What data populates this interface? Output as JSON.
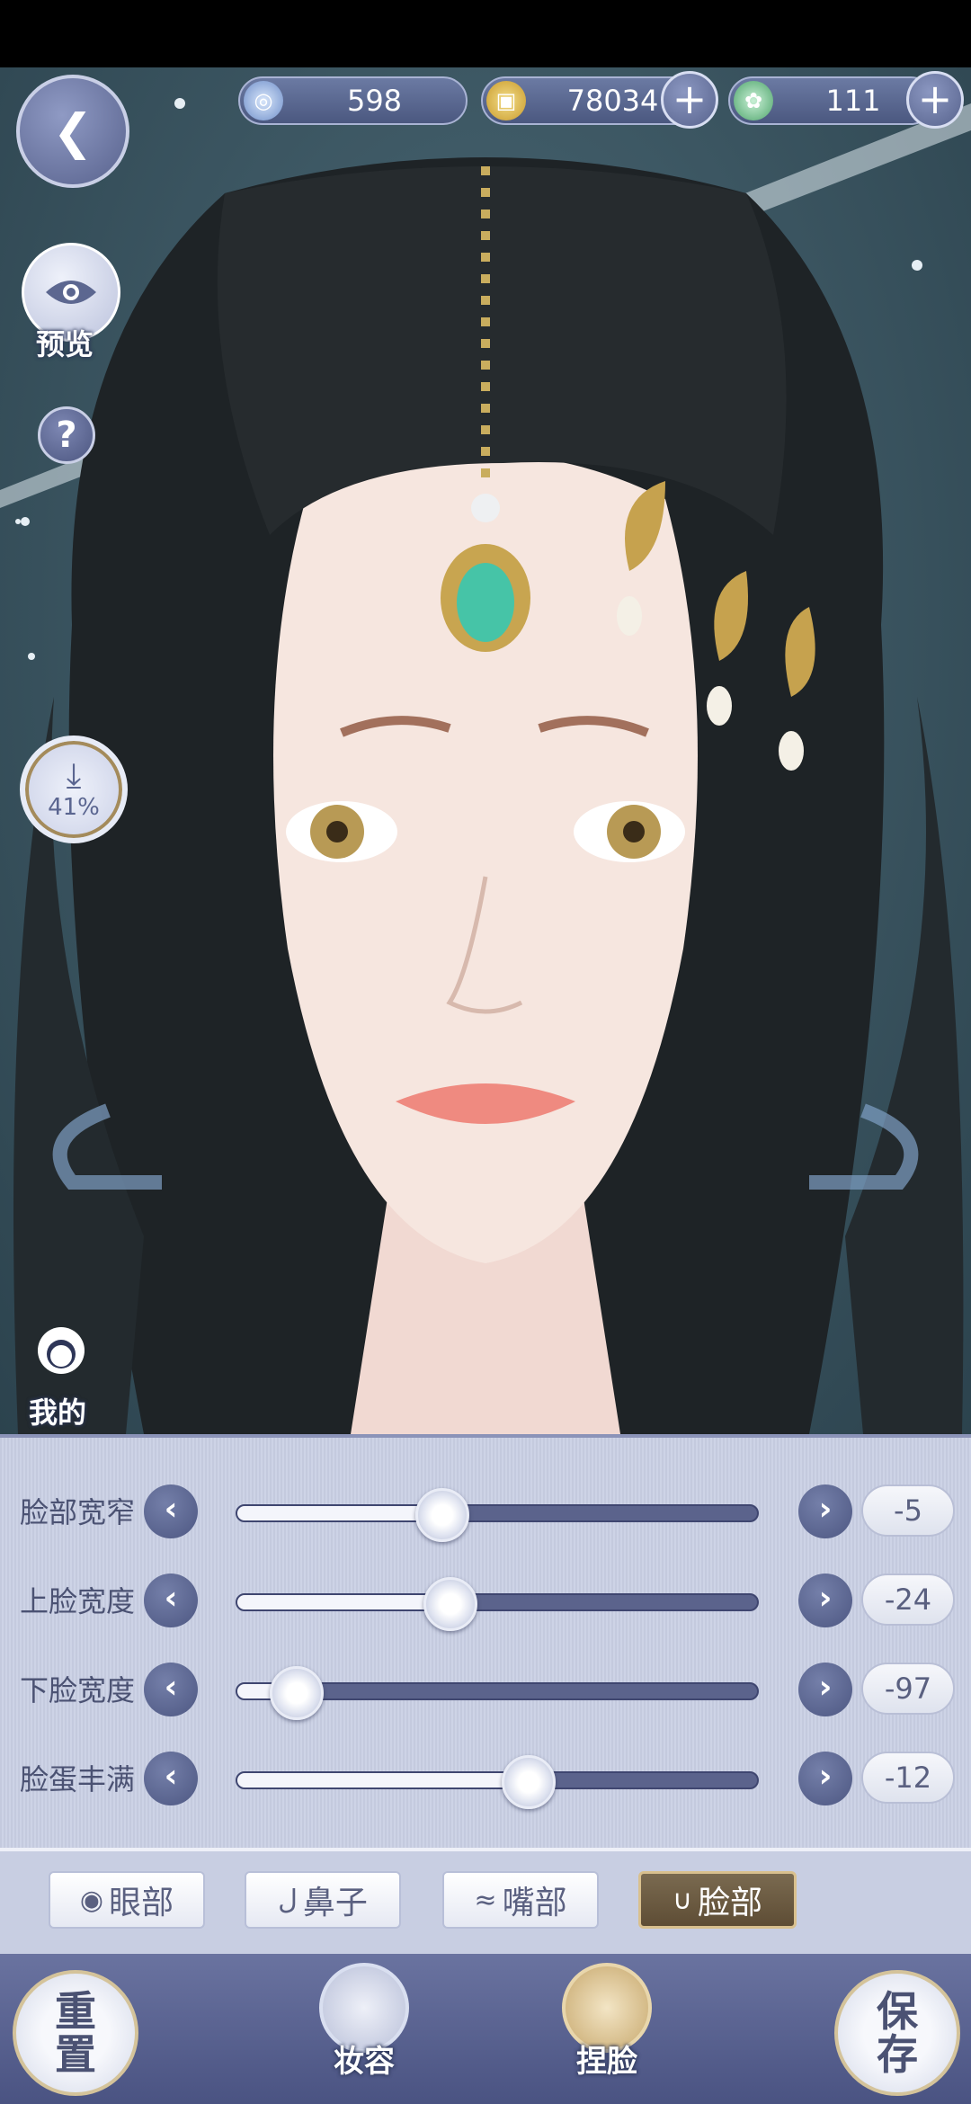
{
  "currency": [
    {
      "icon": "jade-icon",
      "value": "598",
      "color": "#8fb4e6"
    },
    {
      "icon": "copper-coin-icon",
      "value": "78034",
      "color": "#e6c25a"
    },
    {
      "icon": "green-token-icon",
      "value": "111",
      "color": "#7fd39a"
    }
  ],
  "left_tools": {
    "preview_label": "预览",
    "help_symbol": "?",
    "download_percent": "41%",
    "my_label": "我的"
  },
  "sliders": [
    {
      "label": "脸部宽窄",
      "value": "-5",
      "level": 0.395
    },
    {
      "label": "上脸宽度",
      "value": "-24",
      "level": 0.41
    },
    {
      "label": "下脸宽度",
      "value": "-97",
      "level": 0.115
    },
    {
      "label": "脸蛋丰满",
      "value": "-12",
      "level": 0.56
    }
  ],
  "tabs": [
    {
      "label": "眼部",
      "icon": "eye-icon",
      "active": false
    },
    {
      "label": "鼻子",
      "icon": "nose-icon",
      "active": false
    },
    {
      "label": "嘴部",
      "icon": "mouth-icon",
      "active": false
    },
    {
      "label": "脸部",
      "icon": "face-icon",
      "active": true
    }
  ],
  "bottom": {
    "reset_label": "重\n置",
    "makeup_label": "妆容",
    "face_label": "捏脸",
    "save_label": "保\n存"
  },
  "colors": {
    "accent": "#5b638c",
    "gold": "#d9c08e"
  }
}
